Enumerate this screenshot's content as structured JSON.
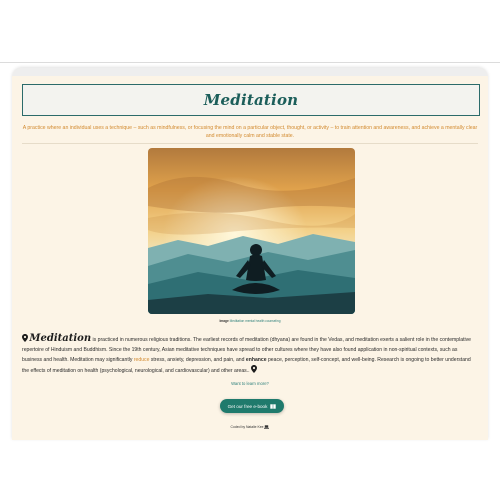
{
  "page": {
    "title": "Meditation",
    "subtitle": "A practice where an individual uses a technique – such as mindfulness, or focusing the mind on a particular object, thought, or activity – to train attention and awareness, and achieve a mentally clear and emotionally calm and stable state."
  },
  "hero": {
    "image_alt": "Silhouette of a person meditating against a sunset over mountains",
    "caption_prefix": "Image",
    "caption_link": "Meditation mental health counseling"
  },
  "article": {
    "lead_word": "Meditation",
    "part1": " is practiced in numerous religious traditions. The earliest records of meditation (dhyana) are found in the Vedas, and meditation exerts a salient role in the contemplative repertoire of Hinduism and Buddhism. Since the 19th century, Asian meditative techniques have spread to other cultures where they have also found application in non-spiritual contexts, such as business and health. Meditation may significantly ",
    "reduce": "reduce",
    "part2": " stress, anxiety, depression, and pain, and ",
    "enhance": "enhance",
    "part3": " peace, perception, self-concept, and well-being. Research is ongoing to better understand the effects of meditation on health (psychological, neurological, and cardiovascular) and other areas.."
  },
  "cta": {
    "question": "Want to learn more?",
    "button_label": "Get our free e-book"
  },
  "footer": {
    "credit": "Coded by Natalie Kee"
  },
  "icons": {
    "pin": "map-pin-icon",
    "book": "book-icon",
    "laptop": "laptop-icon"
  },
  "colors": {
    "accent": "#1b5e5a",
    "orange": "#d28a2f",
    "button": "#1f7a6c",
    "card_bg": "#fcf4e6"
  }
}
